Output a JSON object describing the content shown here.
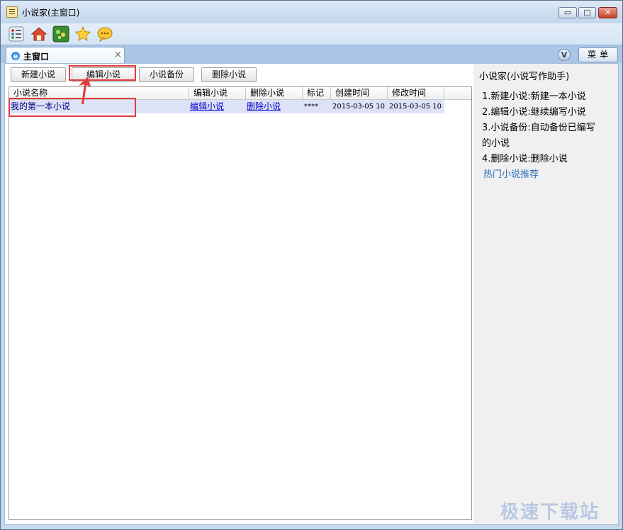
{
  "window": {
    "title": "小说家(主窗口)",
    "min": "▭",
    "max": "□",
    "close": "✕"
  },
  "toolbar": {
    "icons": [
      "settings-icon",
      "home-icon",
      "game-icon",
      "star-icon",
      "chat-icon"
    ]
  },
  "tabs": {
    "active": "主窗口",
    "close": "×",
    "v_label": "V",
    "menu_label": "菜单"
  },
  "actions": {
    "new": "新建小说",
    "edit": "编辑小说",
    "backup": "小说备份",
    "delete": "删除小说"
  },
  "table": {
    "headers": [
      "小说名称",
      "编辑小说",
      "删除小说",
      "标记",
      "创建时间",
      "修改时间"
    ],
    "rows": [
      {
        "name": "我的第一本小说",
        "edit": "编辑小说",
        "delete": "删除小说",
        "mark": "****",
        "created": "2015-03-05 10",
        "modified": "2015-03-05 10"
      }
    ]
  },
  "help": {
    "title": "小说家(小说写作助手)",
    "lines": [
      "1.新建小说:新建一本小说",
      "2.编辑小说:继续编写小说",
      "3.小说备份:自动备份已编写",
      "的小说",
      "4.删除小说:删除小说"
    ],
    "hot_link": "热门小说推荐"
  },
  "watermark": "极速下载站",
  "colors": {
    "accent_red": "#e23b3b",
    "selected_row": "#dde2f7",
    "link": "#0000c8"
  }
}
